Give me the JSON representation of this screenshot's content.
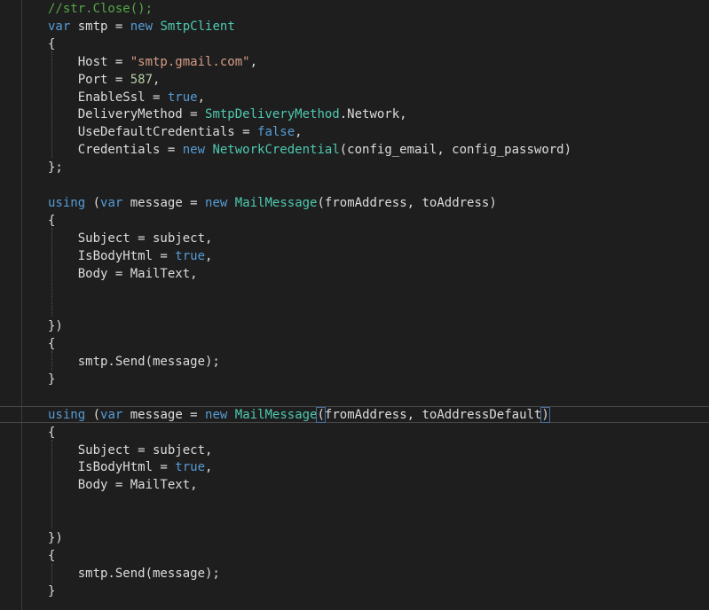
{
  "code": {
    "lines": [
      [
        {
          "t": "//str.Close();",
          "c": "cm"
        }
      ],
      [
        {
          "t": "var",
          "c": "kw"
        },
        {
          "t": " smtp = ",
          "c": "pl"
        },
        {
          "t": "new",
          "c": "kw"
        },
        {
          "t": " ",
          "c": "pl"
        },
        {
          "t": "SmtpClient",
          "c": "ty"
        }
      ],
      [
        {
          "t": "{",
          "c": "pl"
        }
      ],
      [
        {
          "t": "    Host = ",
          "c": "pl"
        },
        {
          "t": "\"smtp.gmail.com\"",
          "c": "str"
        },
        {
          "t": ",",
          "c": "pl"
        }
      ],
      [
        {
          "t": "    Port = ",
          "c": "pl"
        },
        {
          "t": "587",
          "c": "num"
        },
        {
          "t": ",",
          "c": "pl"
        }
      ],
      [
        {
          "t": "    EnableSsl = ",
          "c": "pl"
        },
        {
          "t": "true",
          "c": "kw"
        },
        {
          "t": ",",
          "c": "pl"
        }
      ],
      [
        {
          "t": "    DeliveryMethod = ",
          "c": "pl"
        },
        {
          "t": "SmtpDeliveryMethod",
          "c": "ty"
        },
        {
          "t": ".Network,",
          "c": "pl"
        }
      ],
      [
        {
          "t": "    UseDefaultCredentials = ",
          "c": "pl"
        },
        {
          "t": "false",
          "c": "kw"
        },
        {
          "t": ",",
          "c": "pl"
        }
      ],
      [
        {
          "t": "    Credentials = ",
          "c": "pl"
        },
        {
          "t": "new",
          "c": "kw"
        },
        {
          "t": " ",
          "c": "pl"
        },
        {
          "t": "NetworkCredential",
          "c": "ty"
        },
        {
          "t": "(config_email, config_password)",
          "c": "pl"
        }
      ],
      [
        {
          "t": "};",
          "c": "pl"
        }
      ],
      [],
      [
        {
          "t": "using",
          "c": "kw"
        },
        {
          "t": " (",
          "c": "pl"
        },
        {
          "t": "var",
          "c": "kw"
        },
        {
          "t": " message = ",
          "c": "pl"
        },
        {
          "t": "new",
          "c": "kw"
        },
        {
          "t": " ",
          "c": "pl"
        },
        {
          "t": "MailMessage",
          "c": "ty"
        },
        {
          "t": "(fromAddress, toAddress)",
          "c": "pl"
        }
      ],
      [
        {
          "t": "{",
          "c": "pl"
        }
      ],
      [
        {
          "t": "    Subject = subject,",
          "c": "pl"
        }
      ],
      [
        {
          "t": "    IsBodyHtml = ",
          "c": "pl"
        },
        {
          "t": "true",
          "c": "kw"
        },
        {
          "t": ",",
          "c": "pl"
        }
      ],
      [
        {
          "t": "    Body = MailText,",
          "c": "pl"
        }
      ],
      [],
      [],
      [
        {
          "t": "})",
          "c": "pl"
        }
      ],
      [
        {
          "t": "{",
          "c": "pl"
        }
      ],
      [
        {
          "t": "    smtp.Send(message);",
          "c": "pl"
        }
      ],
      [
        {
          "t": "}",
          "c": "pl"
        }
      ],
      [],
      [
        {
          "t": "using",
          "c": "kw"
        },
        {
          "t": " (",
          "c": "pl"
        },
        {
          "t": "var",
          "c": "kw"
        },
        {
          "t": " message = ",
          "c": "pl"
        },
        {
          "t": "new",
          "c": "kw"
        },
        {
          "t": " ",
          "c": "pl"
        },
        {
          "t": "MailMessage",
          "c": "ty"
        },
        {
          "t": "(",
          "c": "pl",
          "hl": true
        },
        {
          "t": "fromAddress, toAddressDefault",
          "c": "pl"
        },
        {
          "t": ")",
          "c": "pl",
          "hl": true
        }
      ],
      [
        {
          "t": "{",
          "c": "pl"
        }
      ],
      [
        {
          "t": "    Subject = subject,",
          "c": "pl"
        }
      ],
      [
        {
          "t": "    IsBodyHtml = ",
          "c": "pl"
        },
        {
          "t": "true",
          "c": "kw"
        },
        {
          "t": ",",
          "c": "pl"
        }
      ],
      [
        {
          "t": "    Body = MailText,",
          "c": "pl"
        }
      ],
      [],
      [],
      [
        {
          "t": "})",
          "c": "pl"
        }
      ],
      [
        {
          "t": "{",
          "c": "pl"
        }
      ],
      [
        {
          "t": "    smtp.Send(message);",
          "c": "pl"
        }
      ],
      [
        {
          "t": "}",
          "c": "pl"
        }
      ]
    ],
    "current_line_index": 23
  },
  "colors": {
    "background": "#1e1e1e",
    "keyword": "#569cd6",
    "type": "#4ec9b0",
    "string": "#d69d85",
    "number": "#b5cea8",
    "comment": "#57a64a",
    "plain": "#dcdcdc"
  }
}
